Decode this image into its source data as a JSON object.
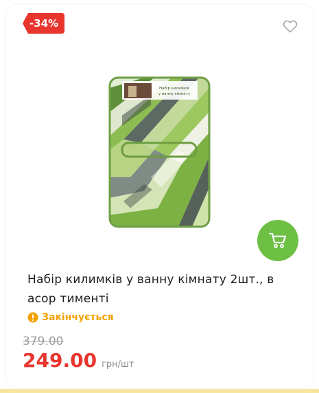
{
  "product": {
    "discount": "-34%",
    "title": "Набір килимків у ванну кімнату 2шт., в асор тименті",
    "stock_status": "Закінчується",
    "old_price": "379.00",
    "new_price": "249.00",
    "unit": "грн/шт",
    "package_label_line1": "Набір килимків",
    "package_label_line2": "у ванну кімнату"
  },
  "icons": {
    "wishlist": "heart-outline-icon",
    "cart": "shopping-cart-icon",
    "status": "warning-circle-icon"
  },
  "colors": {
    "discount_badge": "#e8352e",
    "cart_button": "#6dc044",
    "stock_status": "#f2a100",
    "new_price": "#e8352e",
    "old_price": "#9b9b9b"
  }
}
